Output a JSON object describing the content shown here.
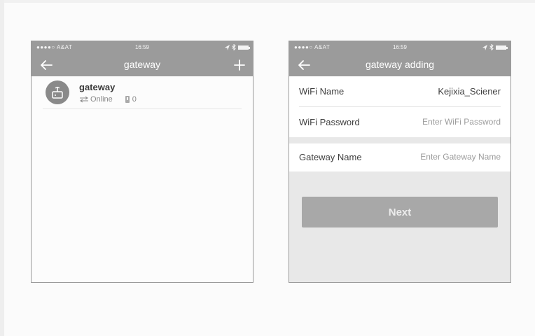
{
  "colors": {
    "nav_bar": "#9b9b9b",
    "nav_text": "#ffffff",
    "button_bg": "#a8a8a8",
    "button_text": "#ececec",
    "form_bg": "#e8e8e8"
  },
  "screen_list": {
    "status_bar": {
      "carrier": "●●●●○ A&AT",
      "time": "16:59",
      "icons": [
        "wifi-icon",
        "location-icon",
        "bluetooth-icon",
        "battery-icon"
      ]
    },
    "nav": {
      "title": "gateway",
      "back_icon": "arrow-left-icon",
      "add_icon": "plus-icon"
    },
    "gateway_item": {
      "name": "gateway",
      "status": "Online",
      "lock_count": "0",
      "icons": [
        "gateway-router-icon",
        "sync-arrows-icon",
        "lock-icon"
      ]
    }
  },
  "screen_add": {
    "status_bar": {
      "carrier": "●●●●○ A&AT",
      "time": "16:59",
      "icons": [
        "wifi-icon",
        "location-icon",
        "bluetooth-icon",
        "battery-icon"
      ]
    },
    "nav": {
      "title": "gateway adding",
      "back_icon": "arrow-left-icon"
    },
    "form": {
      "wifi_name_label": "WiFi Name",
      "wifi_name_value": "Kejixia_Sciener",
      "wifi_password_label": "WiFi Password",
      "wifi_password_placeholder": "Enter WiFi Password",
      "gateway_name_label": "Gateway Name",
      "gateway_name_placeholder": "Enter Gateway Name"
    },
    "next_label": "Next"
  }
}
